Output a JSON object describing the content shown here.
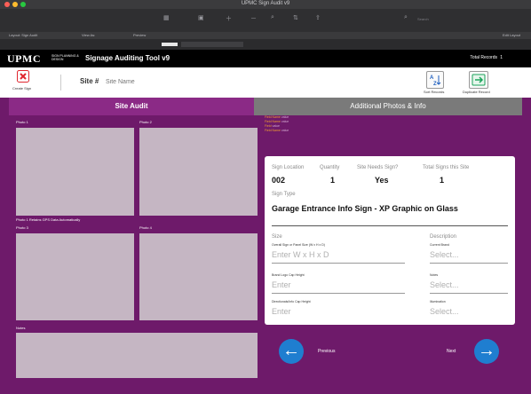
{
  "window": {
    "title": "UPMC Sign Audit v9"
  },
  "toolbar": {
    "layout_label": "Layout: Sign Audit",
    "view_as_label": "View As:",
    "preview_label": "Preview",
    "edit_layout_label": "Edit Layout",
    "search_placeholder": "Search"
  },
  "header": {
    "logo_text": "UPMC",
    "logo_sub": "SIGN PLANNING & DESIGN",
    "app_title": "Signage Auditing Tool",
    "app_version": "v9",
    "total_label": "Total Records",
    "total_value": "1"
  },
  "command": {
    "create_label": "Create Sign",
    "site_label": "Site #",
    "site_placeholder": "Site Name",
    "sort_label": "Sort Records",
    "duplicate_label": "Duplicate Record"
  },
  "tabs": {
    "site_audit": "Site Audit",
    "additional": "Additional Photos & Info"
  },
  "photos": {
    "photo1": "Photo 1",
    "photo2": "Photo 2",
    "photo3": "Photo 3",
    "photo4": "Photo 4",
    "gps_note": "Photo 1 Retains GPS Data Automatically",
    "notes": "Notes"
  },
  "info_rows": [
    {
      "key": "Field Name",
      "value": "value"
    },
    {
      "key": "Field Name",
      "value": "value"
    },
    {
      "key": "Field",
      "value": "value"
    },
    {
      "key": "Field Name",
      "value": "value"
    }
  ],
  "form": {
    "sign_location_label": "Sign Location",
    "sign_location_value": "002",
    "quantity_label": "Quantity",
    "quantity_value": "1",
    "needs_sign_label": "Site Needs Sign?",
    "needs_sign_value": "Yes",
    "total_signs_label": "Total Signs this Site",
    "total_signs_value": "1",
    "sign_type_label": "Sign Type",
    "sign_type_value": "Garage Entrance Info Sign - XP Graphic on Glass",
    "size_label": "Size",
    "overall_size_label": "Overall Sign or Panel Size (W x H x D)",
    "overall_size_placeholder": "Enter W x H x D",
    "description_label": "Description",
    "current_brand_label": "Current Brand",
    "current_brand_placeholder": "Select...",
    "brand_height_label": "Brand Logo Cap Height",
    "brand_height_placeholder": "Enter",
    "notes_label": "Notes",
    "notes_placeholder": "Select...",
    "directional_label": "Directionals/Info Cap Height",
    "directional_placeholder": "Enter",
    "illumination_label": "Illumination",
    "illumination_placeholder": "Select..."
  },
  "nav": {
    "previous_label": "Previous",
    "next_label": "Next"
  },
  "colors": {
    "brand_purple": "#6e1a6a",
    "tab_purple": "#8b2a86",
    "tab_gray": "#7a7a7a",
    "photo_fill": "#c5b6c3",
    "nav_blue": "#1f7ed0",
    "info_key": "#f0a030",
    "create_red": "#e0262e",
    "duplicate_green": "#1aa35a"
  }
}
